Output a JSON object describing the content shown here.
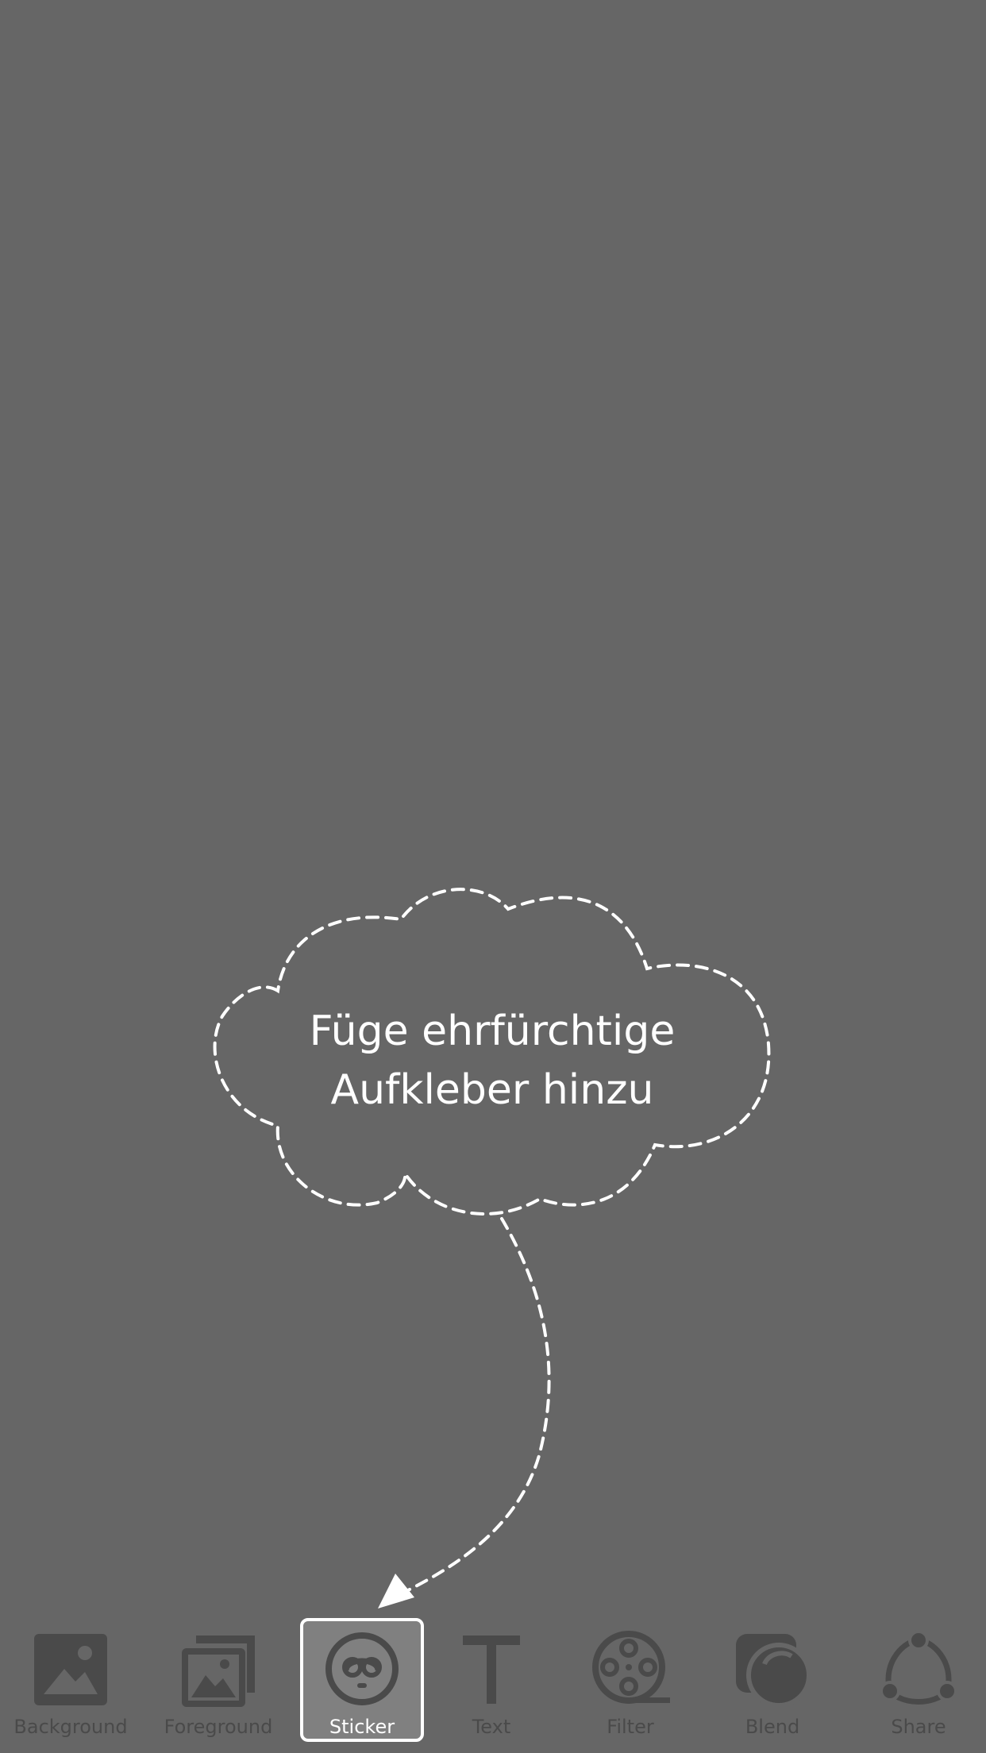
{
  "hint": {
    "line1": "Füge ehrfürchtige",
    "line2": "Aufkleber hinzu"
  },
  "toolbar": {
    "selected": "Sticker",
    "items": [
      {
        "label": "Background",
        "icon": "background-image-icon"
      },
      {
        "label": "Foreground",
        "icon": "foreground-layers-icon"
      },
      {
        "label": "Sticker",
        "icon": "sticker-face-icon"
      },
      {
        "label": "Text",
        "icon": "text-t-icon"
      },
      {
        "label": "Filter",
        "icon": "film-reel-icon"
      },
      {
        "label": "Blend",
        "icon": "blend-icon"
      },
      {
        "label": "Share",
        "icon": "share-icon"
      }
    ]
  },
  "colors": {
    "background": "#666666",
    "icon": "#4a4a4a",
    "accent": "#ffffff",
    "selected_fill": "#808080"
  }
}
